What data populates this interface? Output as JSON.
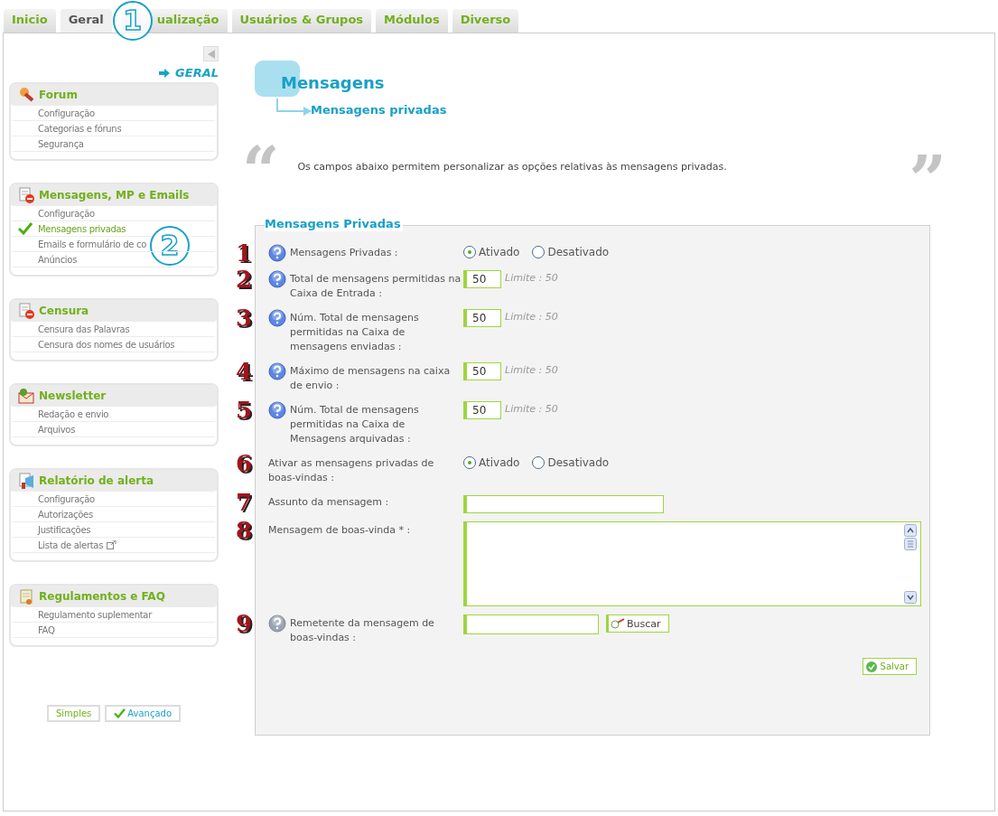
{
  "tabs": [
    {
      "label": "Inicio",
      "selected": false
    },
    {
      "label": "Geral",
      "selected": true
    },
    {
      "label": "ualização",
      "selected": false
    },
    {
      "label": "Usuários & Grupos",
      "selected": false
    },
    {
      "label": "Módulos",
      "selected": false
    },
    {
      "label": "Diverso",
      "selected": false
    }
  ],
  "callouts": [
    {
      "text": "1"
    },
    {
      "text": "2"
    }
  ],
  "sidebar": {
    "breadcrumb": "GERAL",
    "sections": [
      {
        "title": "Forum",
        "items": [
          {
            "label": "Configuração",
            "selected": false
          },
          {
            "label": "Categorias e fóruns",
            "selected": false
          },
          {
            "label": "Segurança",
            "selected": false
          }
        ]
      },
      {
        "title": "Mensagens, MP e Emails",
        "items": [
          {
            "label": "Configuração",
            "selected": false
          },
          {
            "label": "Mensagens privadas",
            "selected": true
          },
          {
            "label": "Emails e formulário de co",
            "selected": false
          },
          {
            "label": "Anúncios",
            "selected": false
          }
        ]
      },
      {
        "title": "Censura",
        "items": [
          {
            "label": "Censura das Palavras",
            "selected": false
          },
          {
            "label": "Censura dos nomes de usuários",
            "selected": false
          }
        ]
      },
      {
        "title": "Newsletter",
        "items": [
          {
            "label": "Redação e envio",
            "selected": false
          },
          {
            "label": "Arquivos",
            "selected": false
          }
        ]
      },
      {
        "title": "Relatório de alerta",
        "items": [
          {
            "label": "Configuração",
            "selected": false
          },
          {
            "label": "Autorizações",
            "selected": false
          },
          {
            "label": "Justificações",
            "selected": false
          },
          {
            "label": "Lista de alertas",
            "selected": false,
            "external": true
          }
        ]
      },
      {
        "title": "Regulamentos e FAQ",
        "items": [
          {
            "label": "Regulamento suplementar",
            "selected": false
          },
          {
            "label": "FAQ",
            "selected": false
          }
        ]
      }
    ],
    "modes": [
      {
        "label": "Simples",
        "selected": false
      },
      {
        "label": "Avançado",
        "selected": true
      }
    ]
  },
  "page": {
    "title": "Mensagens",
    "subtitle": "Mensagens privadas",
    "quote_open": "“",
    "quote_close": "”",
    "intro": "Os campos abaixo permitem personalizar as opções relativas às mensagens privadas."
  },
  "form": {
    "legend": "Mensagens Privadas",
    "rows": [
      {
        "step": "1",
        "help_icon": true,
        "help_disabled": false,
        "label": "Mensagens Privadas :",
        "kind": "radio",
        "options": [
          {
            "label": "Ativado",
            "selected": true
          },
          {
            "label": "Desativado",
            "selected": false
          }
        ]
      },
      {
        "step": "2",
        "help_icon": true,
        "help_disabled": false,
        "label": "Total de mensagens permitidas na Caixa de Entrada :",
        "kind": "number",
        "value": "50",
        "limit": "Limite : 50"
      },
      {
        "step": "3",
        "help_icon": true,
        "help_disabled": false,
        "label": "Núm. Total de mensagens permitidas na Caixa de mensagens enviadas :",
        "kind": "number",
        "value": "50",
        "limit": "Limite : 50"
      },
      {
        "step": "4",
        "help_icon": true,
        "help_disabled": false,
        "label": "Máximo de mensagens na caixa de envio :",
        "kind": "number",
        "value": "50",
        "limit": "Limite : 50"
      },
      {
        "step": "5",
        "help_icon": true,
        "help_disabled": false,
        "label": "Núm. Total de mensagens permitidas na Caixa de Mensagens arquivadas :",
        "kind": "number",
        "value": "50",
        "limit": "Limite : 50"
      },
      {
        "step": "6",
        "help_icon": false,
        "label": "Ativar as mensagens privadas de boas-vindas :",
        "kind": "radio",
        "options": [
          {
            "label": "Ativado",
            "selected": true
          },
          {
            "label": "Desativado",
            "selected": false
          }
        ]
      },
      {
        "step": "7",
        "help_icon": false,
        "label": "Assunto da mensagem :",
        "kind": "text"
      },
      {
        "step": "8",
        "help_icon": false,
        "label": "Mensagem de boas-vinda * :",
        "kind": "textarea"
      },
      {
        "step": "9",
        "help_icon": true,
        "help_disabled": true,
        "label": "Remetente da mensagem de boas-vindas :",
        "kind": "search",
        "button": "Buscar"
      }
    ],
    "submit": "Salvar"
  }
}
